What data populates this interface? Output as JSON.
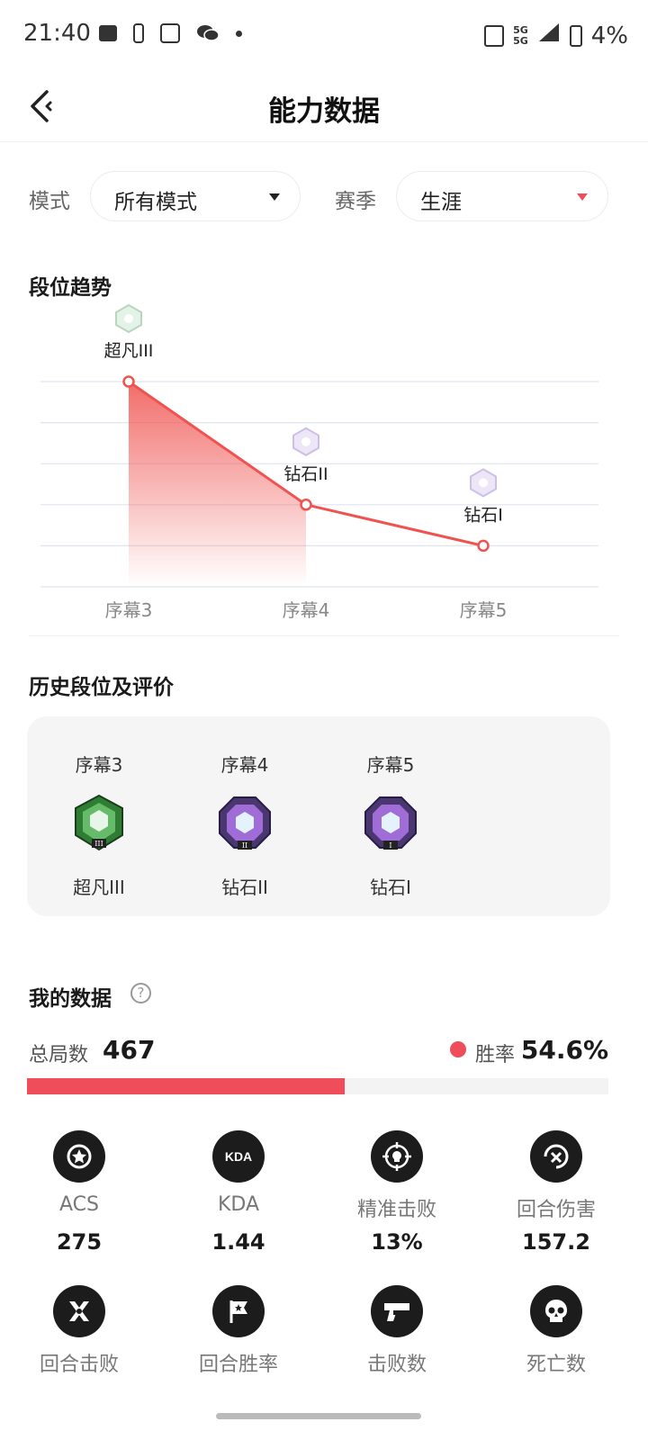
{
  "status_bar": {
    "time": "21:40",
    "network_top": "5G",
    "network_bottom": "5G",
    "battery": "4%"
  },
  "header": {
    "title": "能力数据",
    "back_icon": "back-arrow-icon"
  },
  "filters": {
    "mode_label": "模式",
    "mode_value": "所有模式",
    "season_label": "赛季",
    "season_value": "生涯"
  },
  "trend": {
    "title": "段位趋势"
  },
  "chart_data": {
    "type": "line",
    "x": [
      "序幕3",
      "序幕4",
      "序幕5"
    ],
    "rank_labels": [
      "超凡III",
      "钻石II",
      "钻石I"
    ],
    "values": [
      5,
      2,
      1
    ],
    "ylim": [
      0,
      5
    ],
    "grid": true,
    "color": "#ef5350"
  },
  "history": {
    "title": "历史段位及评价",
    "items": [
      {
        "season": "序幕3",
        "rank": "超凡III",
        "badge": "ascendant-badge-icon"
      },
      {
        "season": "序幕4",
        "rank": "钻石II",
        "badge": "diamond-badge-icon"
      },
      {
        "season": "序幕5",
        "rank": "钻石I",
        "badge": "diamond-badge-icon"
      }
    ]
  },
  "my_data": {
    "title": "我的数据",
    "help": "?",
    "total_label": "总局数",
    "total_value": "467",
    "win_label": "胜率",
    "win_value": "54.6%",
    "win_fraction": 0.546,
    "accent": "#ef4d59",
    "stats": [
      {
        "label": "ACS",
        "value": "275",
        "icon": "star-icon"
      },
      {
        "label": "KDA",
        "value": "1.44",
        "icon": "kda-icon"
      },
      {
        "label": "精准击败",
        "value": "13%",
        "icon": "crosshair-skull-icon"
      },
      {
        "label": "回合伤害",
        "value": "157.2",
        "icon": "damage-icon"
      },
      {
        "label": "回合击败",
        "icon": "crossed-blades-icon"
      },
      {
        "label": "回合胜率",
        "icon": "flag-icon"
      },
      {
        "label": "击败数",
        "icon": "pistol-icon"
      },
      {
        "label": "死亡数",
        "icon": "skull-icon"
      }
    ]
  }
}
